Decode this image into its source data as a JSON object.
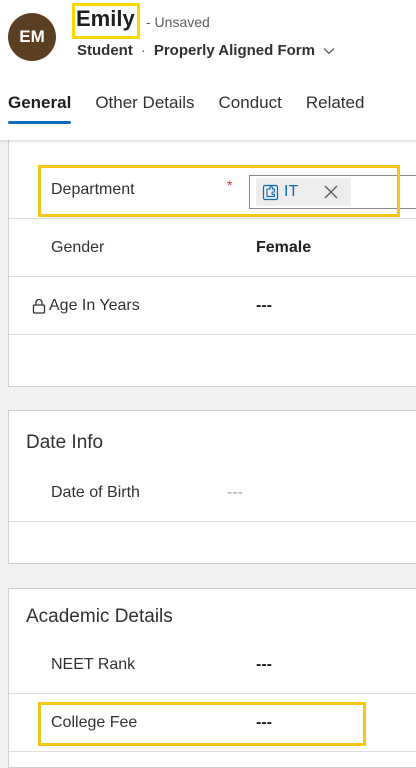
{
  "header": {
    "avatar_initials": "EM",
    "record_name": "Emily",
    "save_status": "- Unsaved",
    "entity_name": "Student",
    "separator": "·",
    "form_name": "Properly Aligned Form"
  },
  "tabs": [
    {
      "label": "General",
      "active": true
    },
    {
      "label": "Other Details",
      "active": false
    },
    {
      "label": "Conduct",
      "active": false
    },
    {
      "label": "Related",
      "active": false
    }
  ],
  "general_section": {
    "fields": {
      "department": {
        "label": "Department",
        "required_marker": "*",
        "value": "IT"
      },
      "gender": {
        "label": "Gender",
        "value": "Female"
      },
      "age": {
        "label": "Age In Years",
        "value": "---"
      }
    }
  },
  "date_section": {
    "title": "Date Info",
    "fields": {
      "dob": {
        "label": "Date of Birth",
        "value": "---"
      }
    }
  },
  "academic_section": {
    "title": "Academic Details",
    "fields": {
      "neet": {
        "label": "NEET Rank",
        "value": "---"
      },
      "fee": {
        "label": "College Fee",
        "value": "---"
      }
    }
  },
  "colors": {
    "accent": "#0f6cbd",
    "avatar_bg": "#5c3f22",
    "highlight": "#f5c518",
    "required": "#d13438"
  },
  "icons": {
    "lookup_entity": "puzzle-icon",
    "lookup_remove": "close-icon",
    "form_selector": "chevron-down-icon",
    "locked_field": "lock-icon"
  }
}
